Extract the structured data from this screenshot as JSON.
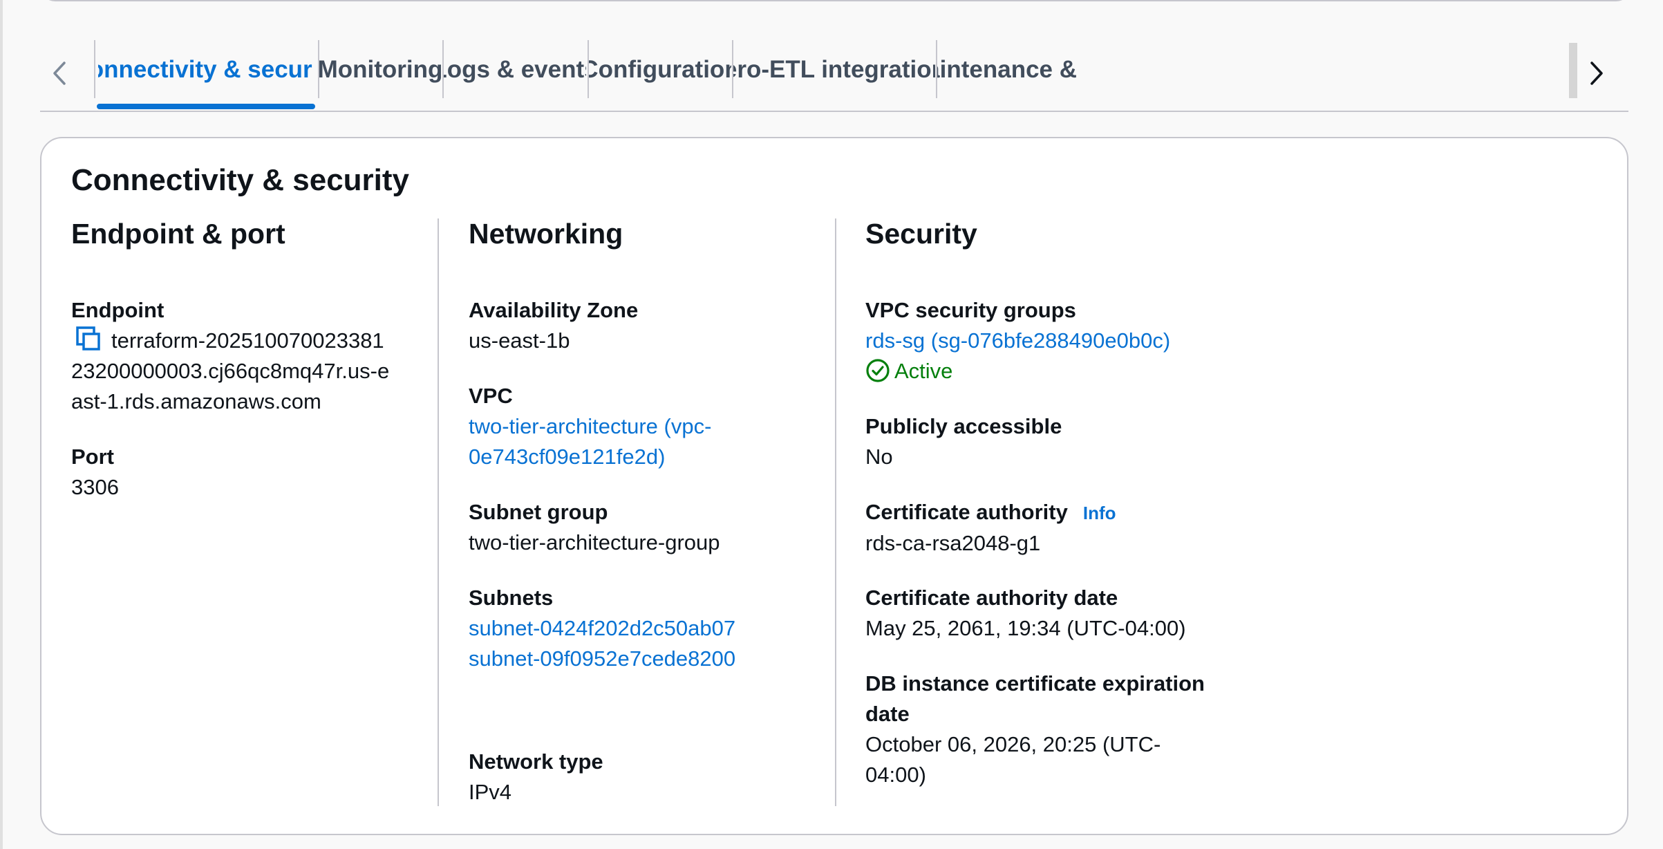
{
  "tabs": [
    {
      "label": "Connectivity & security",
      "active": true
    },
    {
      "label": "Monitoring",
      "active": false
    },
    {
      "label": "Logs & events",
      "active": false
    },
    {
      "label": "Configuration",
      "active": false
    },
    {
      "label": "Zero-ETL integrations",
      "active": false
    },
    {
      "label": "Maintenance &",
      "active": false
    }
  ],
  "panel": {
    "title": "Connectivity & security",
    "endpoint_port": {
      "title": "Endpoint & port",
      "endpoint_label": "Endpoint",
      "endpoint_line1": "terraform-202510070023381",
      "endpoint_line2": "23200000003.cj66qc8mq47r.us-e",
      "endpoint_line3": "ast-1.rds.amazonaws.com",
      "port_label": "Port",
      "port_value": "3306"
    },
    "networking": {
      "title": "Networking",
      "az_label": "Availability Zone",
      "az_value": "us-east-1b",
      "vpc_label": "VPC",
      "vpc_line1": "two-tier-architecture (vpc-",
      "vpc_line2": "0e743cf09e121fe2d)",
      "subnet_group_label": "Subnet group",
      "subnet_group_value": "two-tier-architecture-group",
      "subnets_label": "Subnets",
      "subnets": [
        "subnet-0424f202d2c50ab07",
        "subnet-09f0952e7cede8200"
      ],
      "network_type_label": "Network type",
      "network_type_value": "IPv4"
    },
    "security": {
      "title": "Security",
      "sg_label": "VPC security groups",
      "sg_value": "rds-sg (sg-076bfe288490e0b0c)",
      "sg_status": "Active",
      "public_label": "Publicly accessible",
      "public_value": "No",
      "ca_label": "Certificate authority",
      "ca_info": "Info",
      "ca_value": "rds-ca-rsa2048-g1",
      "ca_date_label": "Certificate authority date",
      "ca_date_value": "May 25, 2061, 19:34 (UTC-04:00)",
      "expiry_label_line1": "DB instance certificate expiration",
      "expiry_label_line2": "date",
      "expiry_value_line1": "October 06, 2026, 20:25 (UTC-",
      "expiry_value_line2": "04:00)"
    }
  },
  "colors": {
    "accent": "#0972d3",
    "success": "#037f0c",
    "border": "#c6c6cd",
    "text": "#0f141a",
    "muted": "#414d5c"
  }
}
